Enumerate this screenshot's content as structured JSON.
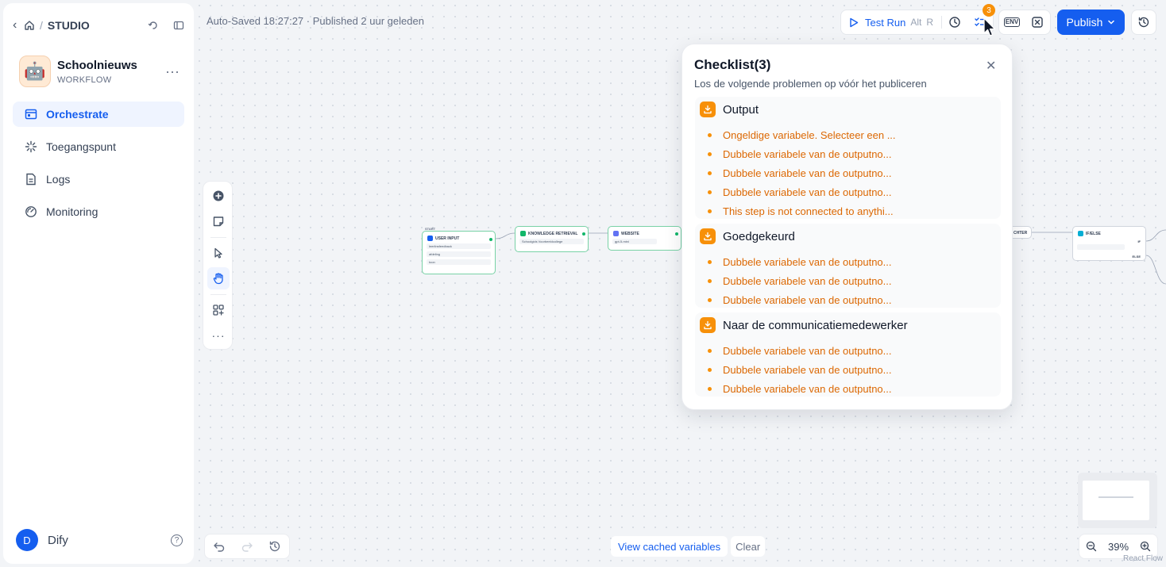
{
  "sidebar": {
    "studio_label": "STUDIO",
    "app_name": "Schoolnieuws",
    "app_type": "WORKFLOW",
    "nav": [
      {
        "label": "Orchestrate"
      },
      {
        "label": "Toegangspunt"
      },
      {
        "label": "Logs"
      },
      {
        "label": "Monitoring"
      }
    ],
    "user_initial": "D",
    "user_name": "Dify"
  },
  "header": {
    "status": "Auto-Saved 18:27:27 · Published 2 uur geleden",
    "test_run_label": "Test Run",
    "test_run_shortcut": "Alt",
    "test_run_key": "R",
    "checklist_badge": "3",
    "env_label": "ENV",
    "publish_label": "Publish"
  },
  "nodes": {
    "start_label": "START",
    "user_input": {
      "title": "USER INPUT",
      "rows": [
        "leerlinsfeedback",
        "afdeling",
        "toon"
      ]
    },
    "knowledge": {
      "title": "KNOWLEDGE RETRIEVAL",
      "rows": [
        "Schoolgids Voorbeeldcollege"
      ]
    },
    "website": {
      "title": "WEBSITE",
      "rows": [
        "gpt-5-mini"
      ]
    },
    "chter": {
      "title": "CHTER"
    },
    "ifelse": {
      "title": "IF/ELSE",
      "if_label": "IF",
      "else_label": "ELSE"
    }
  },
  "checklist": {
    "title": "Checklist(3)",
    "subtitle": "Los de volgende problemen op vóór het publiceren",
    "groups": [
      {
        "name": "Output",
        "items": [
          "Ongeldige variabele. Selecteer een ...",
          "Dubbele variabele van de outputno...",
          "Dubbele variabele van de outputno...",
          "Dubbele variabele van de outputno...",
          "This step is not connected to anythi..."
        ]
      },
      {
        "name": "Goedgekeurd",
        "items": [
          "Dubbele variabele van de outputno...",
          "Dubbele variabele van de outputno...",
          "Dubbele variabele van de outputno..."
        ]
      },
      {
        "name": "Naar de communicatiemedewerker",
        "items": [
          "Dubbele variabele van de outputno...",
          "Dubbele variabele van de outputno...",
          "Dubbele variabele van de outputno..."
        ]
      }
    ]
  },
  "bottom": {
    "view_cached": "View cached variables",
    "clear": "Clear",
    "zoom": "39%",
    "attribution": "React Flow"
  }
}
